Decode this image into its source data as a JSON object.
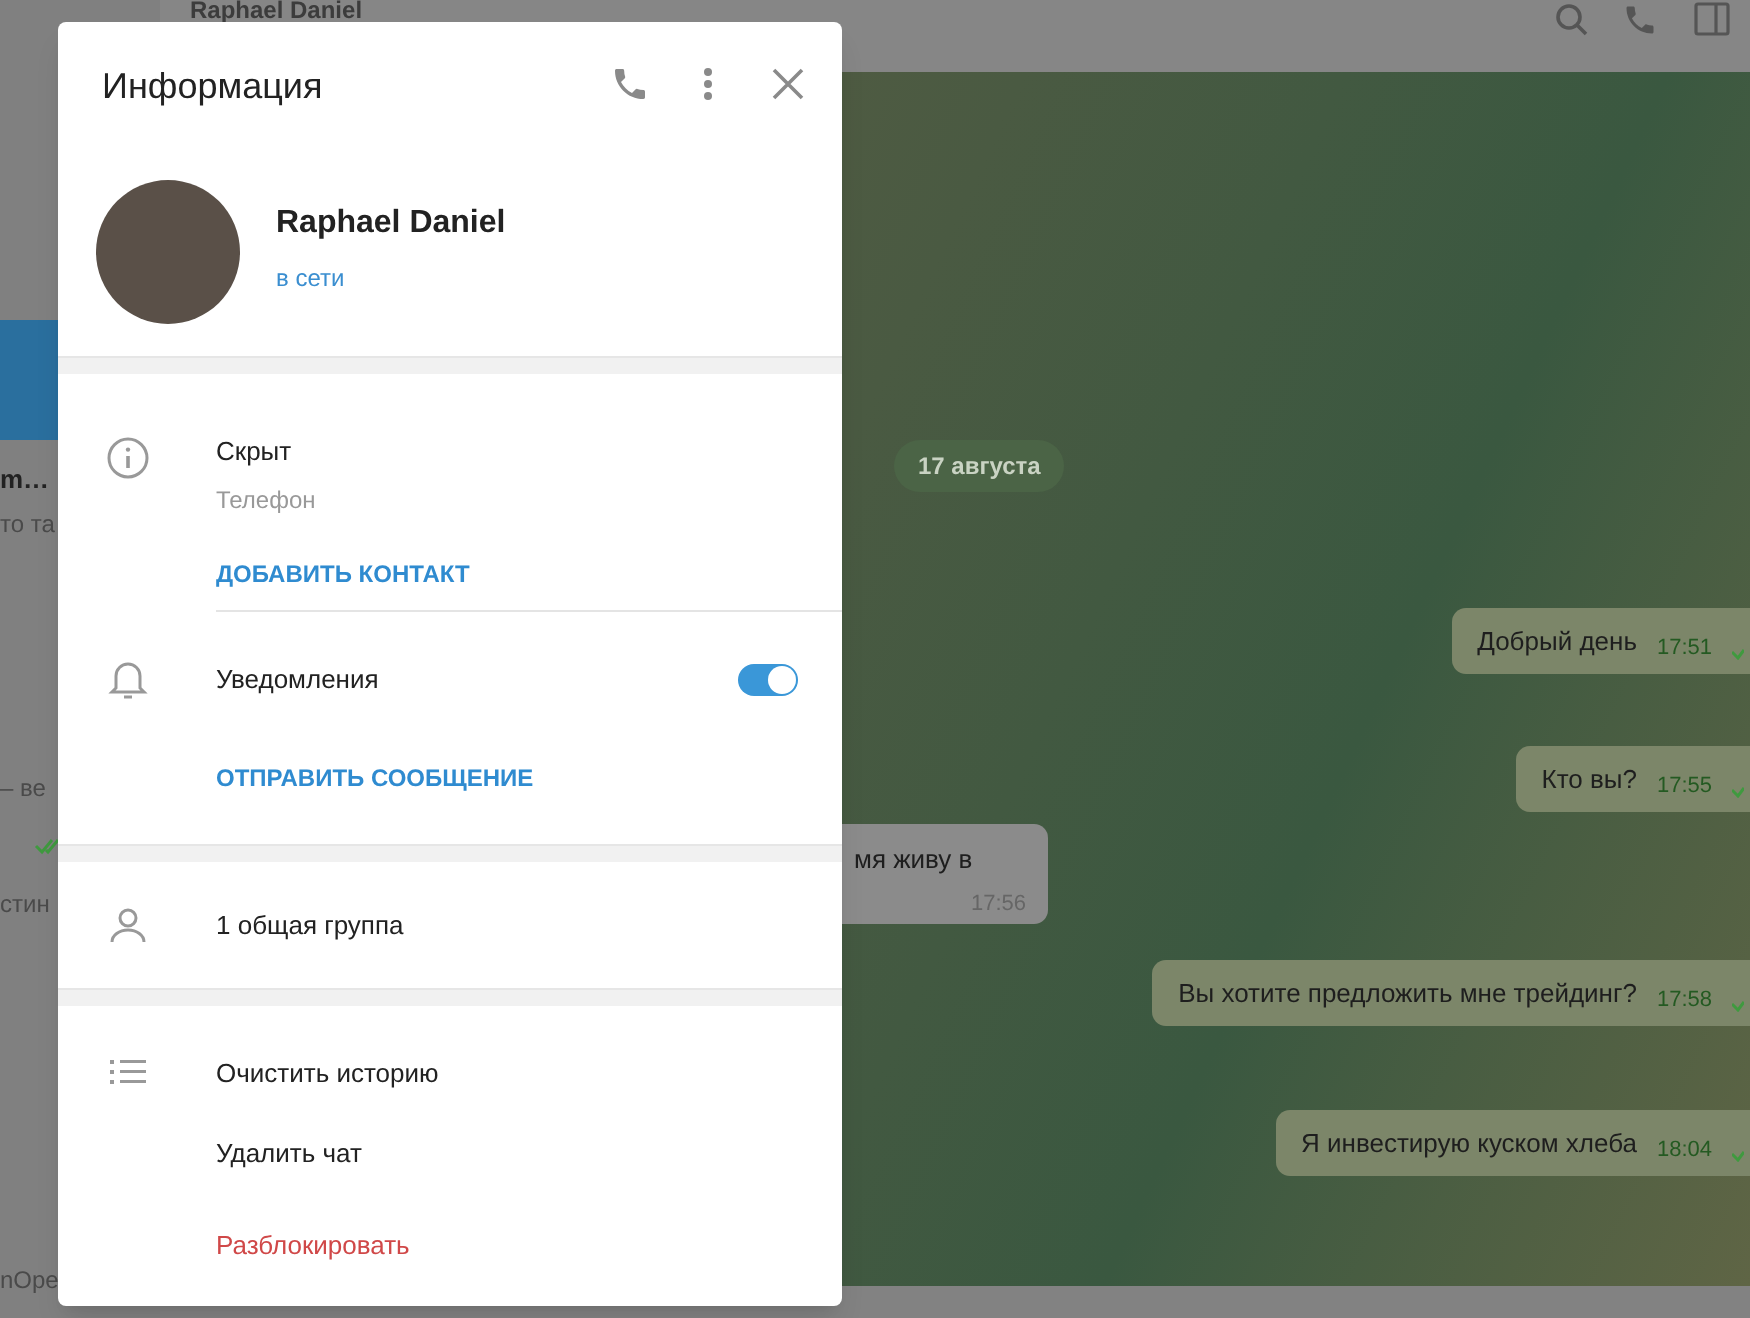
{
  "sidebar": {
    "items": [
      {
        "selected": true
      },
      {
        "title": "m…",
        "preview": "то та",
        "selected": false
      },
      {
        "preview": "– ве",
        "selected": false
      },
      {
        "preview": "стин",
        "read": true,
        "selected": false
      },
      {
        "preview": "nOpe",
        "selected": false
      }
    ]
  },
  "chat_header": {
    "title": "Raphael Daniel"
  },
  "date_badge": "17 августа",
  "messages": [
    {
      "kind": "out",
      "text": "Добрый день",
      "time": "17:51"
    },
    {
      "kind": "out",
      "text": "Кто вы?",
      "time": "17:55"
    },
    {
      "kind": "in",
      "text": "мя живу в",
      "time": "17:56"
    },
    {
      "kind": "out",
      "text": "Вы хотите предложить мне трейдинг?",
      "time": "17:58"
    },
    {
      "kind": "out",
      "text": "Я инвестирую куском хлеба",
      "time": "18:04"
    }
  ],
  "info_panel": {
    "title": "Информация",
    "name": "Raphael Daniel",
    "status": "в сети",
    "phone_value": "Скрыт",
    "phone_label": "Телефон",
    "add_contact": "ДОБАВИТЬ КОНТАКТ",
    "notifications": {
      "label": "Уведомления",
      "on": true
    },
    "send_message": "ОТПРАВИТЬ СООБЩЕНИЕ",
    "groups": "1 общая группа",
    "actions": [
      {
        "label": "Очистить историю",
        "kind": "normal"
      },
      {
        "label": "Удалить чат",
        "kind": "normal"
      },
      {
        "label": "Разблокировать",
        "kind": "danger"
      }
    ]
  }
}
